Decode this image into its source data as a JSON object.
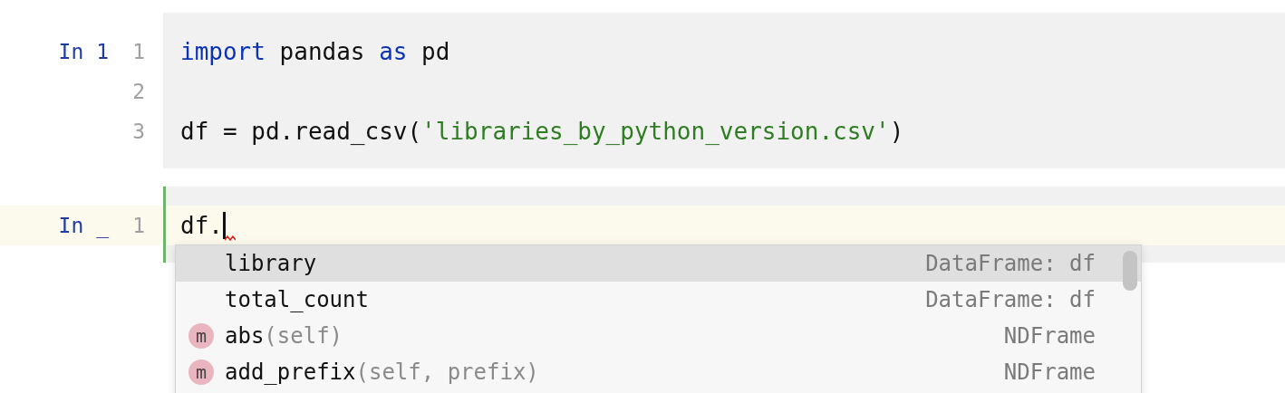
{
  "cells": [
    {
      "prompt": "In 1",
      "active": false,
      "lines": [
        {
          "number": "1",
          "current": false,
          "tokens": [
            {
              "kind": "keyword",
              "text": "import"
            },
            {
              "kind": "plain",
              "text": " pandas "
            },
            {
              "kind": "keyword",
              "text": "as"
            },
            {
              "kind": "plain",
              "text": " pd"
            }
          ]
        },
        {
          "number": "2",
          "current": false
        },
        {
          "number": "3",
          "current": false,
          "tokens": [
            {
              "kind": "plain",
              "text": "df = pd.read_csv("
            },
            {
              "kind": "string",
              "text": "'libraries_by_python_version.csv'"
            },
            {
              "kind": "plain",
              "text": ")"
            }
          ]
        }
      ]
    },
    {
      "prompt": "In _",
      "active": true,
      "lines": [
        {
          "number": "1",
          "current": true,
          "caret": true,
          "error": true,
          "tokens": [
            {
              "kind": "plain",
              "text": "df."
            }
          ]
        }
      ]
    }
  ],
  "completion": {
    "items": [
      {
        "kind": "field",
        "name": "library",
        "type": "DataFrame: df",
        "selected": true
      },
      {
        "kind": "field",
        "name": "total_count",
        "type": "DataFrame: df",
        "selected": false
      },
      {
        "kind": "method",
        "icon_letter": "m",
        "name": "abs",
        "params": "(self)",
        "type": "NDFrame",
        "selected": false
      },
      {
        "kind": "method",
        "icon_letter": "m",
        "name": "add_prefix",
        "params": "(self, prefix)",
        "type": "NDFrame",
        "selected": false
      }
    ]
  }
}
